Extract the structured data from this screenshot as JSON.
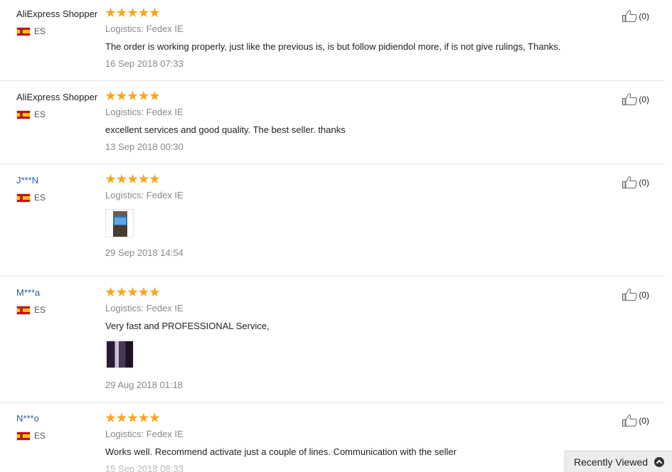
{
  "reviews": [
    {
      "user": "AliExpress Shopper",
      "user_is_link": false,
      "country": "ES",
      "rating": 5,
      "logistics": "Logistics: Fedex IE",
      "text": "The order is working properly, just like the previous is, is but follow pidiendol more, if is not give rulings, Thanks.",
      "date": "16 Sep 2018 07:33",
      "helpful": "(0)"
    },
    {
      "user": "AliExpress Shopper",
      "user_is_link": false,
      "country": "ES",
      "rating": 5,
      "logistics": "Logistics: Fedex IE",
      "text": "excellent services and good quality. The best seller. thanks",
      "date": "13 Sep 2018 00:30",
      "helpful": "(0)"
    },
    {
      "user": "J***N",
      "user_is_link": true,
      "country": "ES",
      "rating": 5,
      "logistics": "Logistics: Fedex IE",
      "text": "",
      "has_photo": true,
      "date": "29 Sep 2018 14:54",
      "helpful": "(0)"
    },
    {
      "user": "M***a",
      "user_is_link": true,
      "country": "ES",
      "rating": 5,
      "logistics": "Logistics: Fedex IE",
      "text": "Very fast and PROFESSIONAL Service,",
      "has_photo": true,
      "date": "29 Aug 2018 01:18",
      "helpful": "(0)"
    },
    {
      "user": "N***o",
      "user_is_link": true,
      "country": "ES",
      "rating": 5,
      "logistics": "Logistics: Fedex IE",
      "text": "Works well. Recommend activate just a couple of lines. Communication with the seller",
      "date": "15 Sep 2018 08:33",
      "helpful": "(0)"
    }
  ],
  "recently_viewed": {
    "label": "Recently Viewed",
    "icon": "chevron-up-circle-icon"
  },
  "colors": {
    "star": "#f7a51c",
    "link": "#2a5ba8",
    "muted": "#888888",
    "divider": "#e7e7e7"
  }
}
